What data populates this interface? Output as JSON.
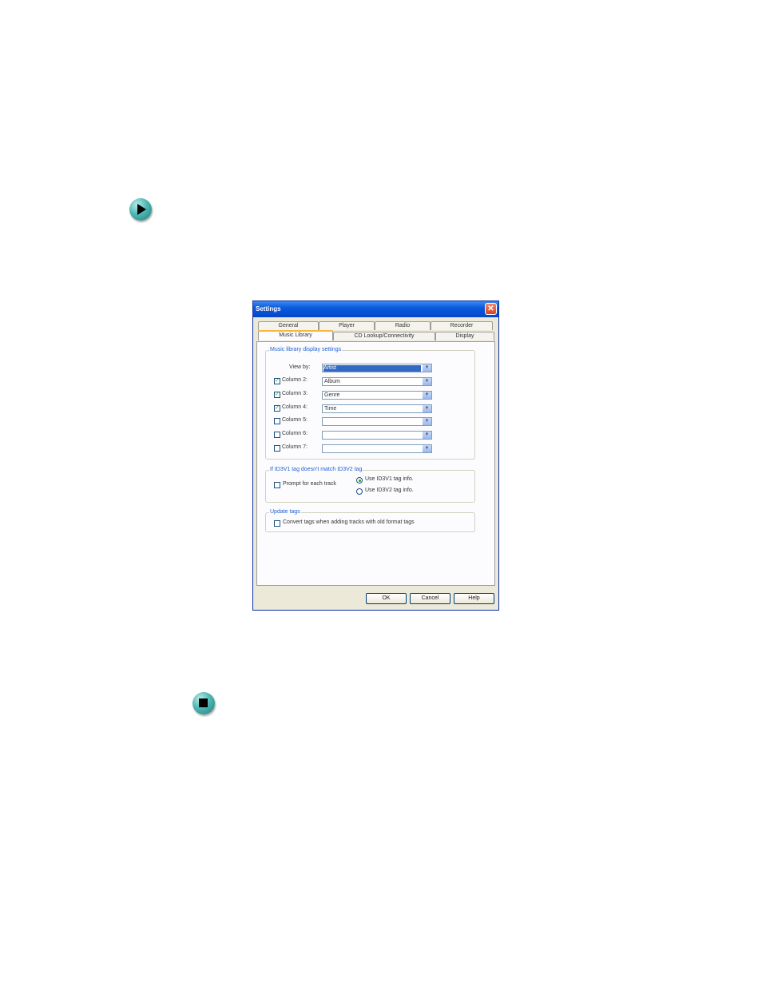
{
  "dialog": {
    "title": "Settings",
    "close_glyph": "✕",
    "tabs_row1": [
      "General",
      "Player",
      "Radio",
      "Recorder"
    ],
    "tabs_row2": [
      "Music Library",
      "CD Lookup/Connectivity",
      "Display"
    ],
    "active_tab": "Music Library",
    "display_group": {
      "label": "Music library display settings",
      "view_by_label": "View by:",
      "view_by_value": "Artist",
      "columns": [
        {
          "label": "Column 2:",
          "checked": true,
          "value": "Album"
        },
        {
          "label": "Column 3:",
          "checked": true,
          "value": "Genre"
        },
        {
          "label": "Column 4:",
          "checked": true,
          "value": "Time"
        },
        {
          "label": "Column 5:",
          "checked": false,
          "value": ""
        },
        {
          "label": "Column 6:",
          "checked": false,
          "value": ""
        },
        {
          "label": "Column 7:",
          "checked": false,
          "value": ""
        }
      ]
    },
    "id3_group": {
      "label": "If ID3V1 tag doesn't match ID3V2 tag",
      "prompt_label": "Prompt for each track",
      "radio1": "Use ID3V1 tag info.",
      "radio2": "Use ID3V2 tag info."
    },
    "update_group": {
      "label": "Update tags",
      "convert_label": "Convert tags when adding tracks with old format tags"
    },
    "buttons": {
      "ok": "OK",
      "cancel": "Cancel",
      "help": "Help"
    }
  },
  "icons": {
    "next": "play-arrow-icon",
    "stop": "stop-icon"
  },
  "colors": {
    "titlebar": "#0a5ae0",
    "group_label": "#1f5fd0",
    "check": "#21a121",
    "nav_icon": "#4fb7b4"
  }
}
